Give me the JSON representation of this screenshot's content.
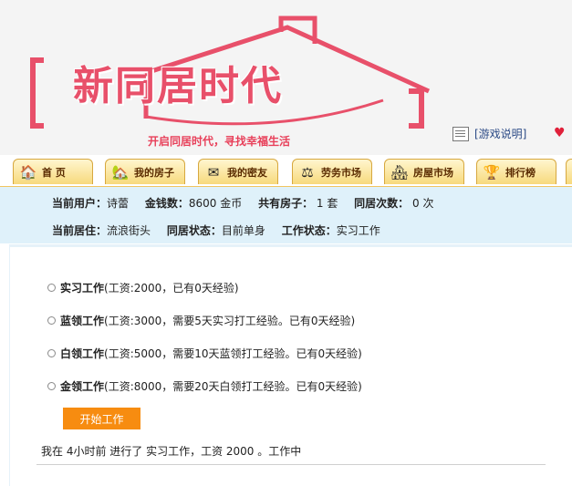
{
  "header": {
    "logo_text": "新同居时代",
    "slogan": "开启同居时代，寻找幸福生活",
    "help_label": "[游戏说明]",
    "accent_color": "#e8506a"
  },
  "nav": {
    "tabs": [
      {
        "label": "首 页",
        "icon": "house-icon"
      },
      {
        "label": "我的房子",
        "icon": "my-house-icon"
      },
      {
        "label": "我的密友",
        "icon": "friend-envelope-icon"
      },
      {
        "label": "劳务市场",
        "icon": "scale-icon"
      },
      {
        "label": "房屋市场",
        "icon": "house-market-icon"
      },
      {
        "label": "排行榜",
        "icon": "ranking-icon"
      }
    ]
  },
  "user_info": {
    "current_user_label": "当前用户：",
    "current_user": "诗蕾",
    "money_label": "金钱数：",
    "money": "8600 金币",
    "houses_label": "共有房子：",
    "houses": " 1 套",
    "cohabit_label": "同居次数：",
    "cohabit": " 0 次",
    "residence_label": "当前居住：",
    "residence": "流浪街头",
    "cohabit_status_label": "同居状态：",
    "cohabit_status": "目前单身",
    "work_status_label": "工作状态：",
    "work_status": "实习工作"
  },
  "jobs": [
    {
      "title": "实习工作",
      "desc": "(工资:2000，已有0天经验)"
    },
    {
      "title": "蓝领工作",
      "desc": "(工资:3000，需要5天实习打工经验。已有0天经验)"
    },
    {
      "title": "白领工作",
      "desc": "(工资:5000，需要10天蓝领打工经验。已有0天经验)"
    },
    {
      "title": "金领工作",
      "desc": "(工资:8000，需要20天白领打工经验。已有0天经验)"
    }
  ],
  "start_button": "开始工作",
  "status_line": "我在 4小时前 进行了 实习工作，工资 2000 。工作中"
}
